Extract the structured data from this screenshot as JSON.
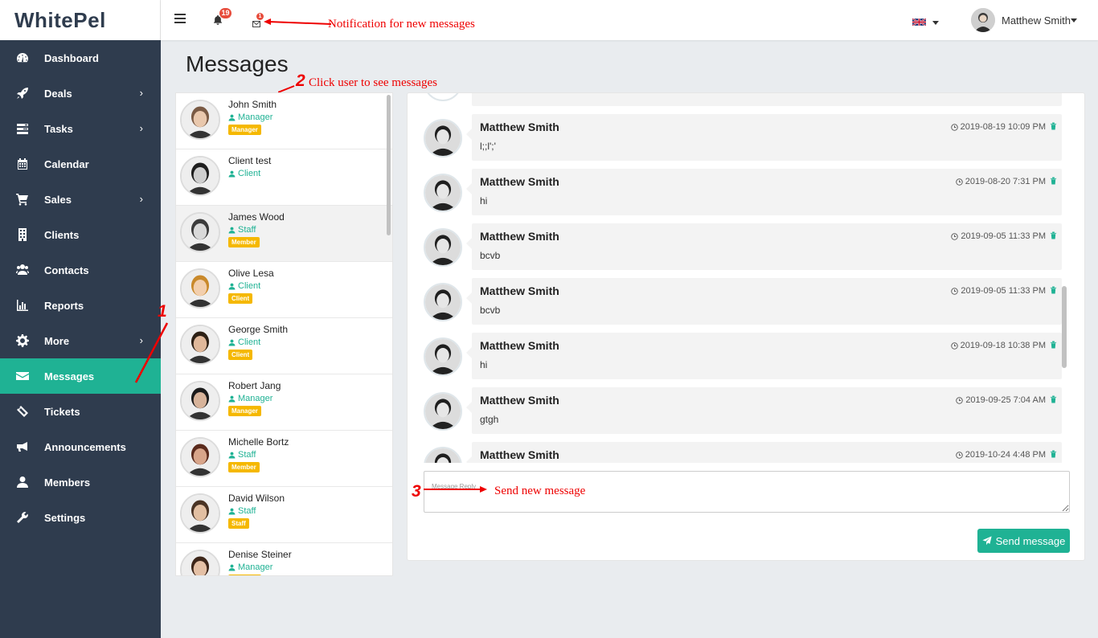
{
  "app": {
    "logo": "WhitePel"
  },
  "sidebar": {
    "items": [
      {
        "label": "Dashboard",
        "icon": "dashboard-icon",
        "chevron": false
      },
      {
        "label": "Deals",
        "icon": "rocket-icon",
        "chevron": true
      },
      {
        "label": "Tasks",
        "icon": "tasks-icon",
        "chevron": true
      },
      {
        "label": "Calendar",
        "icon": "calendar-icon",
        "chevron": false
      },
      {
        "label": "Sales",
        "icon": "cart-icon",
        "chevron": true
      },
      {
        "label": "Clients",
        "icon": "building-icon",
        "chevron": false
      },
      {
        "label": "Contacts",
        "icon": "users-icon",
        "chevron": false
      },
      {
        "label": "Reports",
        "icon": "bar-chart-icon",
        "chevron": false
      },
      {
        "label": "More",
        "icon": "gear-icon",
        "chevron": true
      },
      {
        "label": "Messages",
        "icon": "envelope-icon",
        "chevron": false,
        "active": true
      },
      {
        "label": "Tickets",
        "icon": "ticket-icon",
        "chevron": false
      },
      {
        "label": "Announcements",
        "icon": "megaphone-icon",
        "chevron": false
      },
      {
        "label": "Members",
        "icon": "user-icon",
        "chevron": false
      },
      {
        "label": "Settings",
        "icon": "wrench-icon",
        "chevron": false
      }
    ]
  },
  "topbar": {
    "notifications_count": "19",
    "messages_count": "1",
    "user_name": "Matthew Smith"
  },
  "annotations": {
    "notification": "Notification for new messages",
    "click_user_num": "2",
    "click_user": "Click user to see messages",
    "sidebar_num": "1",
    "send_num": "3",
    "send": "Send new message"
  },
  "page": {
    "title": "Messages"
  },
  "contacts": [
    {
      "name": "John Smith",
      "role": "Manager",
      "badge": "Manager"
    },
    {
      "name": "Client test",
      "role": "Client",
      "badge": ""
    },
    {
      "name": "James Wood",
      "role": "Staff",
      "badge": "Member",
      "selected": true
    },
    {
      "name": "Olive Lesa",
      "role": "Client",
      "badge": "Client"
    },
    {
      "name": "George Smith",
      "role": "Client",
      "badge": "Client"
    },
    {
      "name": "Robert Jang",
      "role": "Manager",
      "badge": "Manager"
    },
    {
      "name": "Michelle Bortz",
      "role": "Staff",
      "badge": "Member"
    },
    {
      "name": "David Wilson",
      "role": "Staff",
      "badge": "Staff"
    },
    {
      "name": "Denise Steiner",
      "role": "Manager",
      "badge": "Manager"
    }
  ],
  "messages": [
    {
      "sender": "Matthew Smith",
      "text": "l;;l';'",
      "time": "2019-08-19 10:09 PM"
    },
    {
      "sender": "Matthew Smith",
      "text": "hi",
      "time": "2019-08-20 7:31 PM"
    },
    {
      "sender": "Matthew Smith",
      "text": "bcvb",
      "time": "2019-09-05 11:33 PM"
    },
    {
      "sender": "Matthew Smith",
      "text": "bcvb",
      "time": "2019-09-05 11:33 PM"
    },
    {
      "sender": "Matthew Smith",
      "text": "hi",
      "time": "2019-09-18 10:38 PM"
    },
    {
      "sender": "Matthew Smith",
      "text": "gtgh",
      "time": "2019-09-25 7:04 AM"
    },
    {
      "sender": "Matthew Smith",
      "text": "",
      "time": "2019-10-24 4:48 PM"
    }
  ],
  "composer": {
    "placeholder": "Message Reply",
    "send_label": "Send message"
  },
  "colors": {
    "accent": "#1fb294",
    "sidebar": "#2f3c4e",
    "badge": "#f5b800",
    "annotation": "#e00000"
  }
}
